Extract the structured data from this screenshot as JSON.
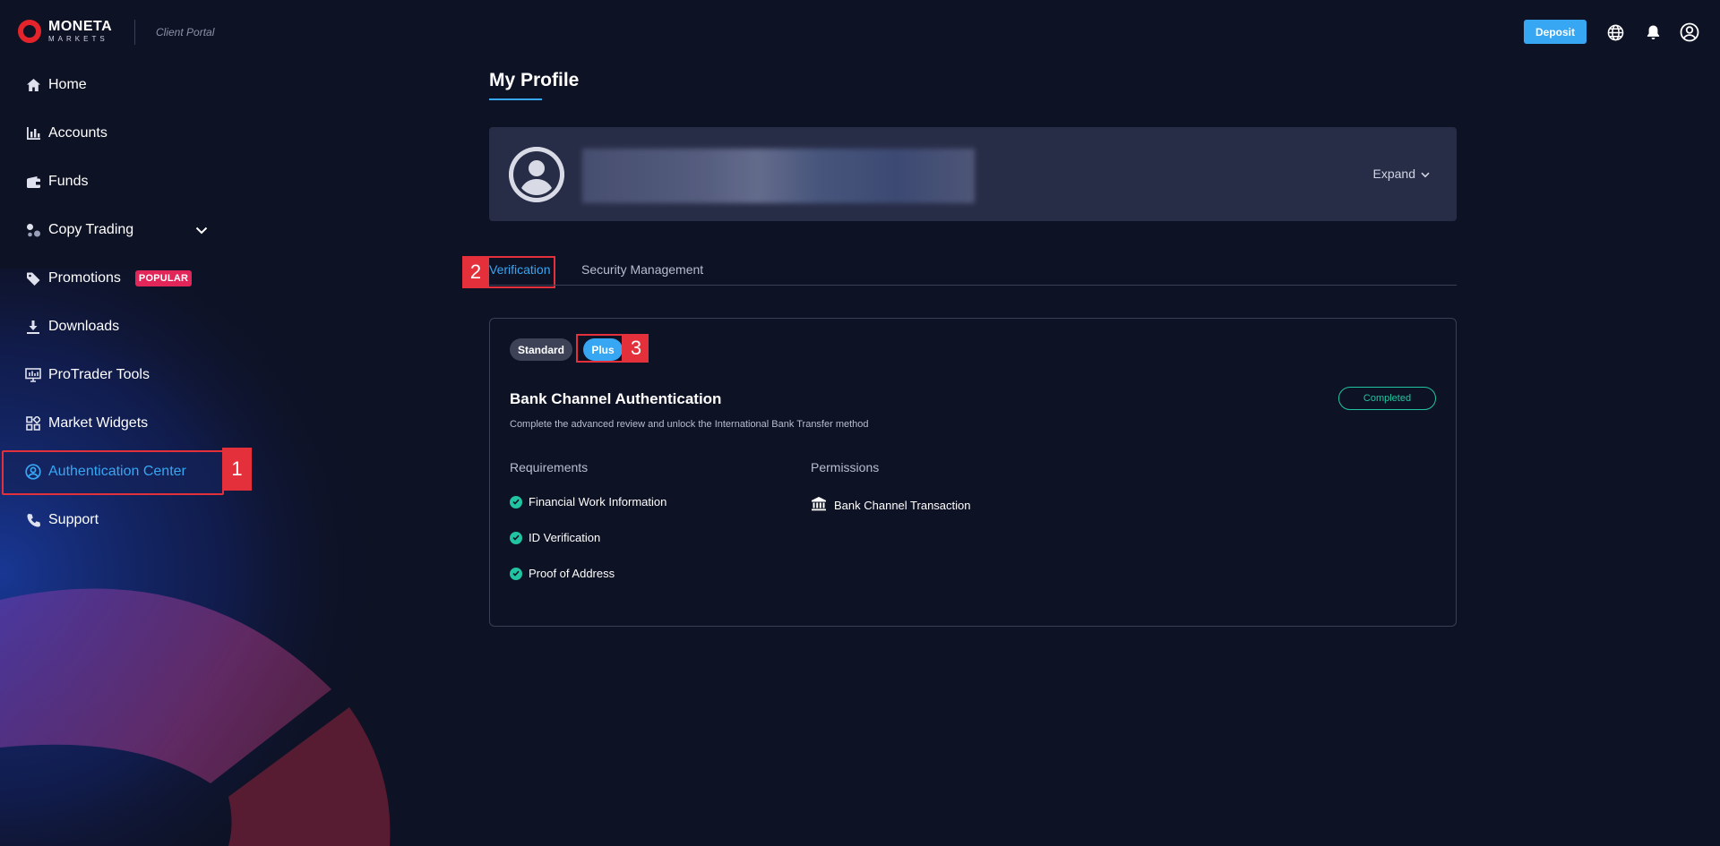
{
  "header": {
    "brand_top": "MONETA",
    "brand_bottom": "MARKETS",
    "portal": "Client Portal",
    "deposit_label": "Deposit",
    "icons": [
      "globe-icon",
      "bell-icon",
      "user-circle-icon"
    ]
  },
  "sidebar": {
    "items": [
      {
        "label": "Home",
        "icon": "home-icon"
      },
      {
        "label": "Accounts",
        "icon": "bar-chart-icon"
      },
      {
        "label": "Funds",
        "icon": "wallet-icon"
      },
      {
        "label": "Copy Trading",
        "icon": "copy-trading-icon"
      },
      {
        "label": "Promotions",
        "icon": "tag-icon",
        "badge": "POPULAR"
      },
      {
        "label": "Downloads",
        "icon": "download-icon"
      },
      {
        "label": "ProTrader Tools",
        "icon": "monitor-icon"
      },
      {
        "label": "Market Widgets",
        "icon": "widgets-icon"
      },
      {
        "label": "Authentication Center",
        "icon": "user-circle-icon",
        "active": true
      },
      {
        "label": "Support",
        "icon": "phone-icon"
      }
    ]
  },
  "annotations": {
    "a1": "1",
    "a2": "2",
    "a3": "3"
  },
  "main": {
    "title": "My Profile",
    "expand_label": "Expand",
    "tabs": [
      {
        "label": "Verification",
        "active": true
      },
      {
        "label": "Security Management",
        "active": false
      }
    ],
    "levels": [
      {
        "label": "Standard",
        "active": false
      },
      {
        "label": "Plus",
        "active": true
      }
    ],
    "auth": {
      "title": "Bank Channel Authentication",
      "description": "Complete the advanced review and unlock the International Bank Transfer method",
      "status": "Completed",
      "requirements_label": "Requirements",
      "permissions_label": "Permissions",
      "requirements": [
        "Financial Work Information",
        "ID Verification",
        "Proof of Address"
      ],
      "permissions": [
        "Bank Channel Transaction"
      ]
    }
  },
  "colors": {
    "background": "#0e1225",
    "accent": "#37a6f3",
    "success": "#20c4a0",
    "annotation": "#e3303a",
    "popular": "#e3265a"
  }
}
